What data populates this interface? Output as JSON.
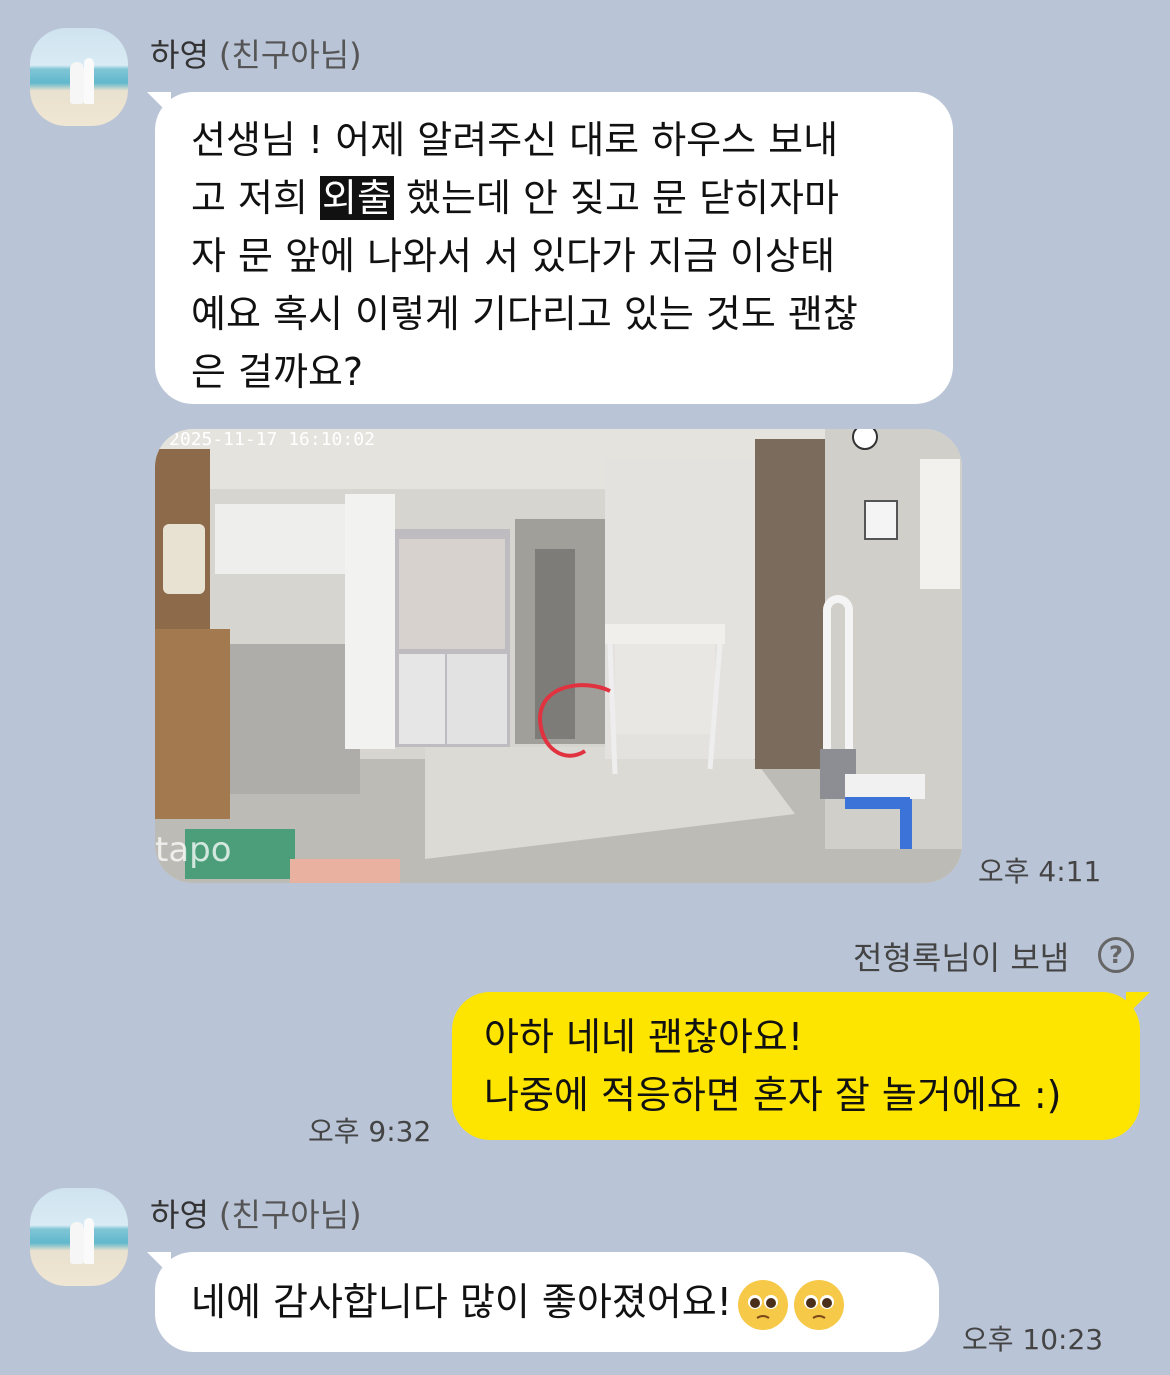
{
  "messages": [
    {
      "sender": {
        "name": "하영",
        "tag": "(친구아님)"
      },
      "lines": [
        "선생님 ! 어제 알려주신 대로  하우스 보내",
        [
          "고 저희 ",
          "외출",
          " 했는데 안 짖고 문 닫히자마"
        ],
        "자 문 앞에 나와서 서 있다가 지금 이상태",
        "예요 혹시 이렇게 기다리고 있는 것도 괜찮",
        "은 걸까요?"
      ],
      "highlight": "외출"
    },
    {
      "photo": {
        "timestamp": "2025-11-17  16:10:02",
        "watermark": "tapo"
      },
      "time": "오후 4:11"
    },
    {
      "status": "전형록님이 보냄",
      "status_icon": "question-icon"
    },
    {
      "mine": true,
      "lines": [
        "아하 네네 괜찮아요!",
        "나중에 적응하면 혼자 잘 놀거에요 :)"
      ],
      "time": "오후 9:32"
    },
    {
      "sender": {
        "name": "하영",
        "tag": "(친구아님)"
      },
      "text": "네에 감사합니다 많이 좋아졌어요!",
      "emojis": [
        "pleading-face-icon",
        "pleading-face-icon"
      ],
      "time": "오후 10:23"
    }
  ],
  "colors": {
    "background": "#b9c4d7",
    "my_bubble": "#fee500",
    "their_bubble": "#ffffff",
    "annotation": "#e0323f"
  }
}
